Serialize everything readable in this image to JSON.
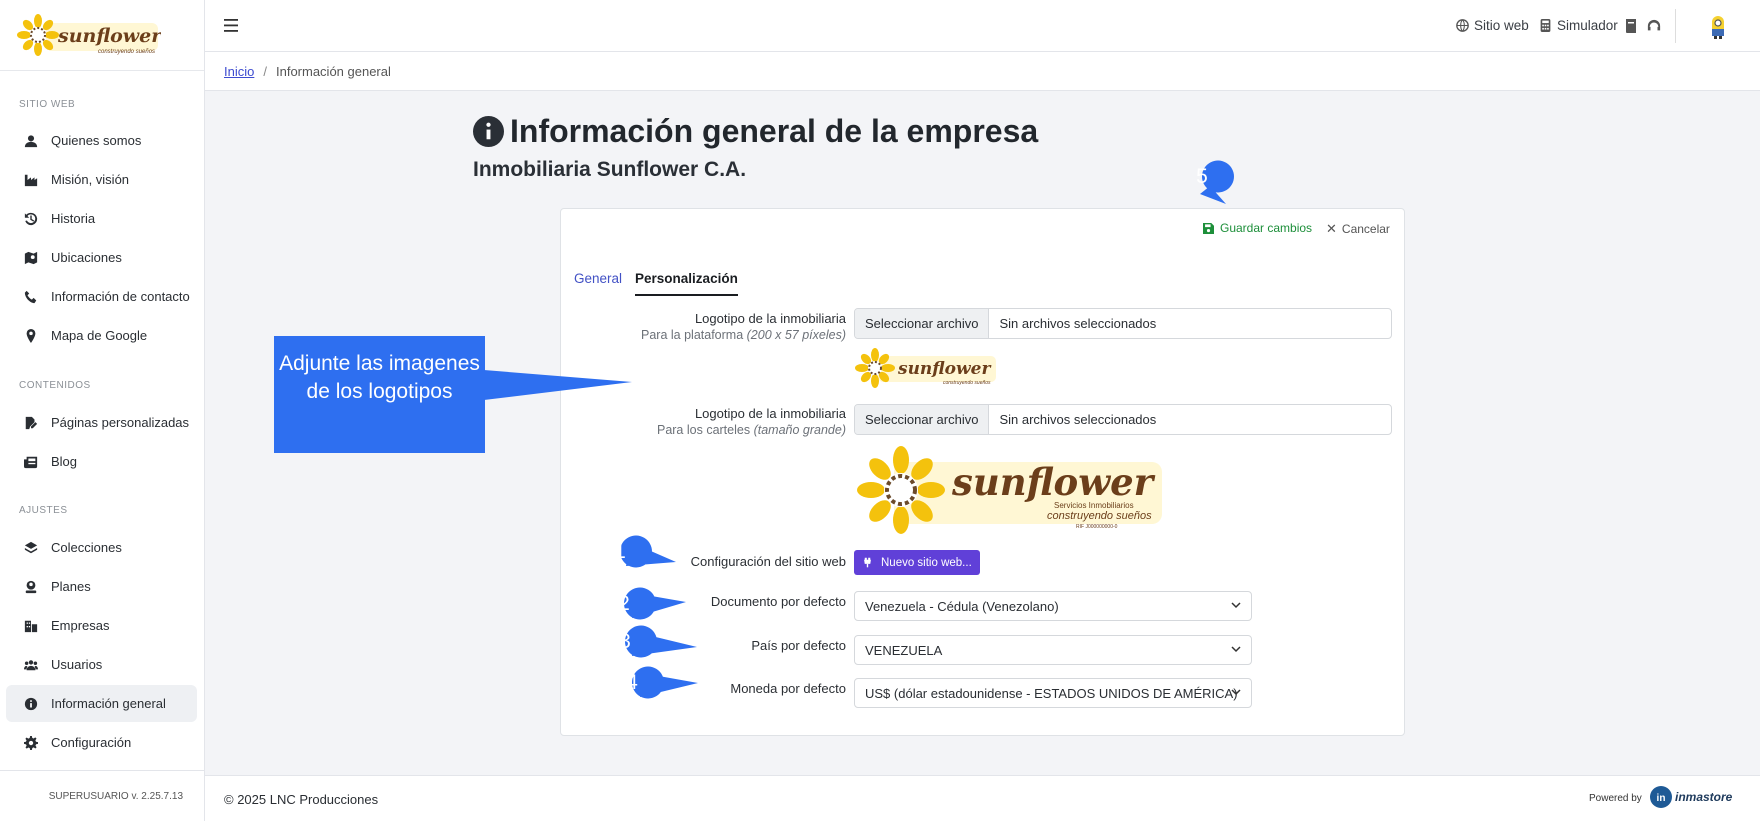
{
  "brand": {
    "name": "sunflower",
    "tagline": "construyendo sueños"
  },
  "sidebar": {
    "sections": [
      {
        "title": "SITIO WEB",
        "items": [
          {
            "label": "Quienes somos",
            "icon": "user-icon"
          },
          {
            "label": "Misión, visión",
            "icon": "industry-icon"
          },
          {
            "label": "Historia",
            "icon": "history-icon"
          },
          {
            "label": "Ubicaciones",
            "icon": "map-location-icon"
          },
          {
            "label": "Información de contacto",
            "icon": "phone-icon"
          },
          {
            "label": "Mapa de Google",
            "icon": "map-marker-icon"
          }
        ]
      },
      {
        "title": "CONTENIDOS",
        "items": [
          {
            "label": "Páginas personalizadas",
            "icon": "file-edit-icon"
          },
          {
            "label": "Blog",
            "icon": "newspaper-icon"
          }
        ]
      },
      {
        "title": "AJUSTES",
        "items": [
          {
            "label": "Colecciones",
            "icon": "layers-icon"
          },
          {
            "label": "Planes",
            "icon": "user-badge-icon"
          },
          {
            "label": "Empresas",
            "icon": "buildings-icon"
          },
          {
            "label": "Usuarios",
            "icon": "users-icon"
          },
          {
            "label": "Información general",
            "icon": "info-icon",
            "active": true
          },
          {
            "label": "Configuración",
            "icon": "gear-icon"
          }
        ]
      }
    ],
    "footer": "SUPERUSUARIO v. 2.25.7.13"
  },
  "topbar": {
    "menu_icon": "hamburger-icon",
    "links": [
      "Sitio web",
      "Simulador"
    ]
  },
  "breadcrumb": {
    "home": "Inicio",
    "current": "Información general"
  },
  "page": {
    "title": "Información general de la empresa",
    "subtitle": "Inmobiliaria Sunflower C.A."
  },
  "card": {
    "save": "Guardar cambios",
    "cancel": "Cancelar",
    "tabs": [
      "General",
      "Personalización"
    ],
    "logo1": {
      "label": "Logotipo de la inmobiliaria",
      "sub": "Para la plataforma",
      "sub_em": "(200 x 57 píxeles)"
    },
    "logo2": {
      "label": "Logotipo de la inmobiliaria",
      "sub": "Para los carteles",
      "sub_em": "(tamaño grande)"
    },
    "file_button": "Seleccionar archivo",
    "file_none": "Sin archivos seleccionados",
    "site_config": {
      "label": "Configuración del sitio web",
      "button": "Nuevo sitio web..."
    },
    "doc_default": {
      "label": "Documento por defecto",
      "value": "Venezuela - Cédula (Venezolano)"
    },
    "country_default": {
      "label": "País por defecto",
      "value": "VENEZUELA"
    },
    "currency_default": {
      "label": "Moneda por defecto",
      "value": "US$ (dólar estadounidense - ESTADOS UNIDOS DE AMÉRICA)"
    },
    "logo_large": {
      "line1": "Servicios Inmobiliarios",
      "line2": "construyendo sueños",
      "rif": "RIF J000000000-0"
    }
  },
  "annotations": {
    "callout": "Adjunte las imagenes de los logotipos",
    "numbers": [
      "1",
      "2",
      "3",
      "4",
      "5"
    ],
    "color": "#2e6ff0"
  },
  "footer": {
    "copyright": "© 2025 LNC Producciones",
    "powered": "Powered by",
    "vendor": "inmastore"
  }
}
